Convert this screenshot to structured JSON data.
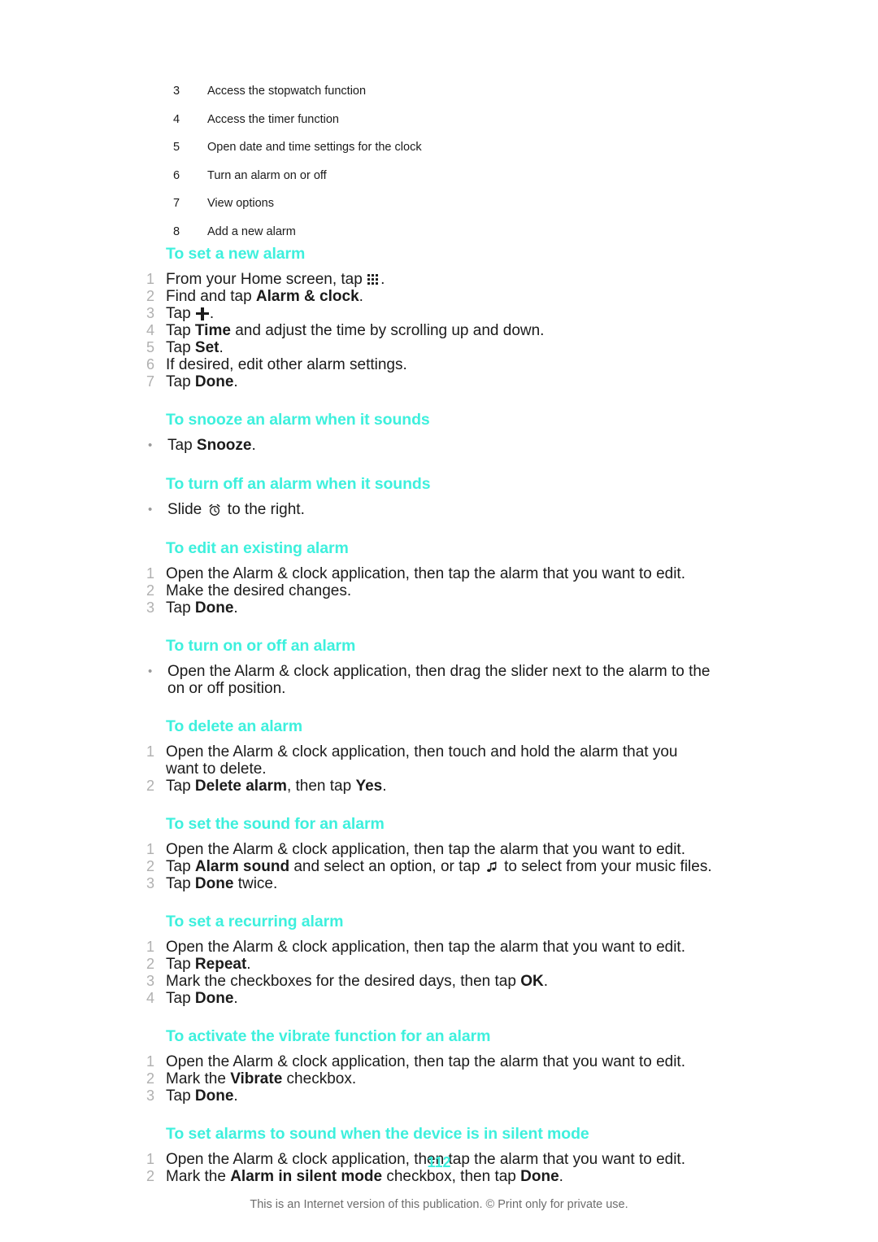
{
  "legend": {
    "items": [
      {
        "num": "3",
        "text": "Access the stopwatch function"
      },
      {
        "num": "4",
        "text": "Access the timer function"
      },
      {
        "num": "5",
        "text": "Open date and time settings for the clock"
      },
      {
        "num": "6",
        "text": "Turn an alarm on or off"
      },
      {
        "num": "7",
        "text": "View options"
      },
      {
        "num": "8",
        "text": "Add a new alarm"
      }
    ]
  },
  "sections": {
    "set_new_alarm": {
      "title": "To set a new alarm",
      "steps": {
        "s1": {
          "marker": "1",
          "pre": "From your Home screen, tap ",
          "post": "."
        },
        "s2": {
          "marker": "2",
          "pre": "Find and tap ",
          "bold": "Alarm & clock",
          "post": "."
        },
        "s3": {
          "marker": "3",
          "pre": "Tap ",
          "post": "."
        },
        "s4": {
          "marker": "4",
          "pre": "Tap ",
          "bold": "Time",
          "post": " and adjust the time by scrolling up and down."
        },
        "s5": {
          "marker": "5",
          "pre": "Tap ",
          "bold": "Set",
          "post": "."
        },
        "s6": {
          "marker": "6",
          "pre": "If desired, edit other alarm settings."
        },
        "s7": {
          "marker": "7",
          "pre": "Tap ",
          "bold": "Done",
          "post": "."
        }
      }
    },
    "snooze_alarm": {
      "title": "To snooze an alarm when it sounds",
      "steps": {
        "s1": {
          "marker": "•",
          "pre": "Tap ",
          "bold": "Snooze",
          "post": "."
        }
      }
    },
    "turn_off_alarm": {
      "title": "To turn off an alarm when it sounds",
      "steps": {
        "s1": {
          "marker": "•",
          "pre": "Slide ",
          "post": " to the right."
        }
      }
    },
    "edit_alarm": {
      "title": "To edit an existing alarm",
      "steps": {
        "s1": {
          "marker": "1",
          "pre": "Open the Alarm & clock application, then tap the alarm that you want to edit."
        },
        "s2": {
          "marker": "2",
          "pre": "Make the desired changes."
        },
        "s3": {
          "marker": "3",
          "pre": "Tap ",
          "bold": "Done",
          "post": "."
        }
      }
    },
    "turn_on_off_alarm": {
      "title": "To turn on or off an alarm",
      "steps": {
        "s1": {
          "marker": "•",
          "pre": "Open the Alarm & clock application, then drag the slider next to the alarm to the on or off position."
        }
      }
    },
    "delete_alarm": {
      "title": "To delete an alarm",
      "steps": {
        "s1": {
          "marker": "1",
          "pre": "Open the Alarm & clock application, then touch and hold the alarm that you want to delete."
        },
        "s2": {
          "marker": "2",
          "pre": "Tap ",
          "bold": "Delete alarm",
          "mid": ", then tap ",
          "bold2": "Yes",
          "post": "."
        }
      }
    },
    "alarm_sound": {
      "title": "To set the sound for an alarm",
      "steps": {
        "s1": {
          "marker": "1",
          "pre": "Open the Alarm & clock application, then tap the alarm that you want to edit."
        },
        "s2": {
          "marker": "2",
          "pre": "Tap ",
          "bold": "Alarm sound",
          "mid": " and select an option, or tap ",
          "post": " to select from your music files."
        },
        "s3": {
          "marker": "3",
          "pre": "Tap ",
          "bold": "Done",
          "post": " twice."
        }
      }
    },
    "recurring_alarm": {
      "title": "To set a recurring alarm",
      "steps": {
        "s1": {
          "marker": "1",
          "pre": "Open the Alarm & clock application, then tap the alarm that you want to edit."
        },
        "s2": {
          "marker": "2",
          "pre": "Tap ",
          "bold": "Repeat",
          "post": "."
        },
        "s3": {
          "marker": "3",
          "pre": "Mark the checkboxes for the desired days, then tap ",
          "bold": "OK",
          "post": "."
        },
        "s4": {
          "marker": "4",
          "pre": "Tap ",
          "bold": "Done",
          "post": "."
        }
      }
    },
    "vibrate_alarm": {
      "title": "To activate the vibrate function for an alarm",
      "steps": {
        "s1": {
          "marker": "1",
          "pre": "Open the Alarm & clock application, then tap the alarm that you want to edit."
        },
        "s2": {
          "marker": "2",
          "pre": "Mark the ",
          "bold": "Vibrate",
          "post": " checkbox."
        },
        "s3": {
          "marker": "3",
          "pre": "Tap ",
          "bold": "Done",
          "post": "."
        }
      }
    },
    "silent_mode_alarm": {
      "title": "To set alarms to sound when the device is in silent mode",
      "steps": {
        "s1": {
          "marker": "1",
          "pre": "Open the Alarm & clock application, then tap the alarm that you want to edit."
        },
        "s2": {
          "marker": "2",
          "pre": "Mark the ",
          "bold": "Alarm in silent mode",
          "mid": " checkbox, then tap ",
          "bold2": "Done",
          "post": "."
        }
      }
    }
  },
  "footer": {
    "page_number": "112",
    "note": "This is an Internet version of this publication. © Print only for private use."
  },
  "icons": {
    "app_drawer": "app-drawer-grid-icon",
    "plus": "plus-icon",
    "alarm_clock": "alarm-clock-icon",
    "music_note": "music-note-icon"
  },
  "colors": {
    "heading": "#3ef0dd",
    "body_text": "#1b1b1b",
    "marker": "#b0b0b0",
    "footer_note": "#6d6d6d"
  }
}
